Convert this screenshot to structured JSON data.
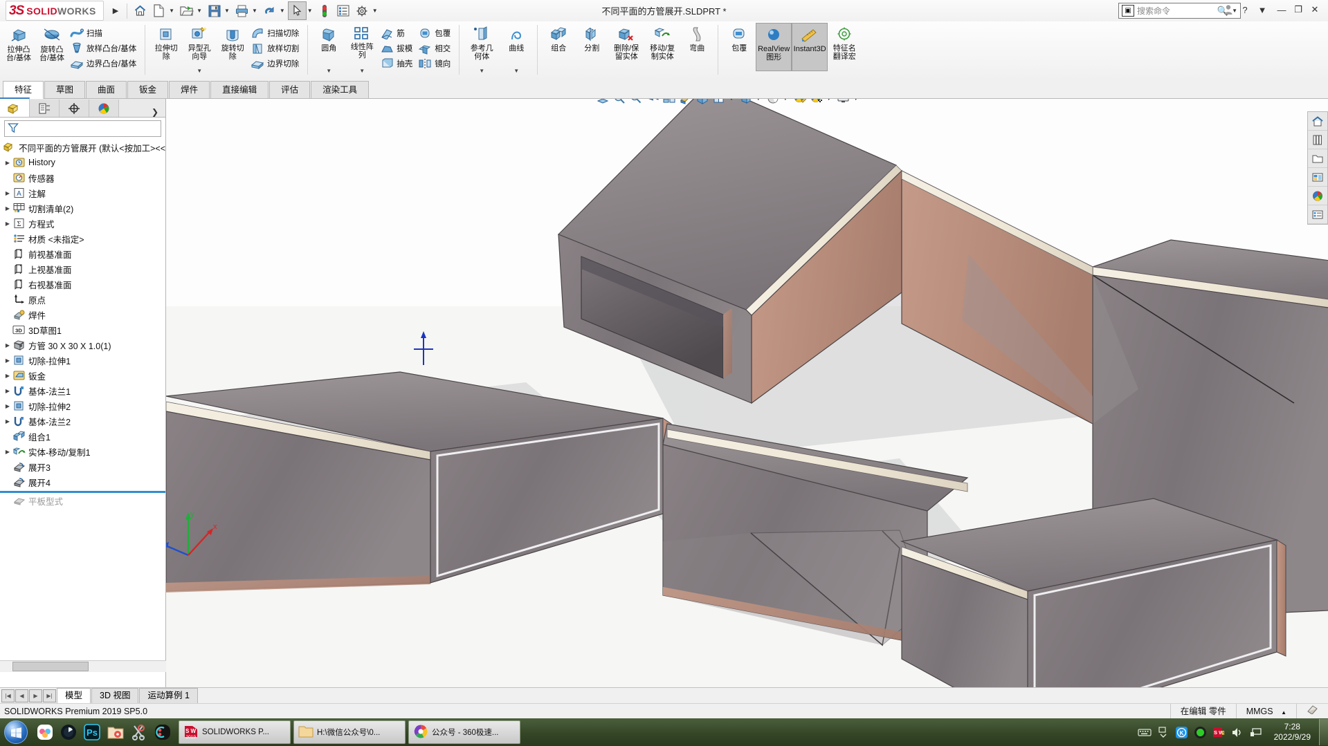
{
  "titlebar": {
    "brand_ds": "3S",
    "brand_solid": "SOLID",
    "brand_works": "WORKS",
    "document_title": "不同平面的方管展开.SLDPRT *",
    "search_placeholder": "搜索命令",
    "icons": [
      "home-icon",
      "new-doc-icon",
      "open-folder-icon",
      "save-icon",
      "print-icon",
      "undo-icon",
      "select-cursor-icon",
      "rebuild-icon",
      "options-list-icon",
      "gear-icon"
    ],
    "help_label": "?",
    "minimize_label": "—",
    "maximize_label": "❐",
    "close_label": "✕"
  },
  "ribbon": {
    "groups": [
      {
        "big": [
          {
            "label": "拉伸凸\n台/基体",
            "icon": "extrude-boss-icon"
          },
          {
            "label": "旋转凸\n台/基体",
            "icon": "revolve-boss-icon"
          }
        ],
        "small": [
          {
            "label": "扫描",
            "icon": "sweep-icon"
          },
          {
            "label": "放样凸台/基体",
            "icon": "loft-boss-icon"
          },
          {
            "label": "边界凸台/基体",
            "icon": "boundary-boss-icon"
          }
        ]
      },
      {
        "big": [
          {
            "label": "拉伸切\n除",
            "icon": "extrude-cut-icon"
          },
          {
            "label": "异型孔\n向导",
            "icon": "hole-wizard-icon",
            "dropdown": true
          },
          {
            "label": "旋转切\n除",
            "icon": "revolve-cut-icon"
          }
        ],
        "small": [
          {
            "label": "扫描切除",
            "icon": "sweep-cut-icon"
          },
          {
            "label": "放样切割",
            "icon": "loft-cut-icon"
          },
          {
            "label": "边界切除",
            "icon": "boundary-cut-icon"
          }
        ]
      },
      {
        "big": [
          {
            "label": "圆角",
            "icon": "fillet-icon",
            "dropdown": true
          },
          {
            "label": "线性阵\n列",
            "icon": "linear-pattern-icon",
            "dropdown": true
          }
        ],
        "small": [
          {
            "label": "筋",
            "icon": "rib-icon"
          },
          {
            "label": "拔模",
            "icon": "draft-icon"
          },
          {
            "label": "抽壳",
            "icon": "shell-icon"
          }
        ],
        "small2": [
          {
            "label": "包覆",
            "icon": "wrap-icon"
          },
          {
            "label": "相交",
            "icon": "intersect-icon"
          },
          {
            "label": "镜向",
            "icon": "mirror-icon"
          }
        ]
      },
      {
        "big": [
          {
            "label": "参考几\n何体",
            "icon": "reference-geometry-icon",
            "dropdown": true
          },
          {
            "label": "曲线",
            "icon": "curves-icon",
            "dropdown": true
          }
        ]
      },
      {
        "big": [
          {
            "label": "组合",
            "icon": "combine-icon"
          },
          {
            "label": "分割",
            "icon": "split-icon"
          },
          {
            "label": "删除/保\n留实体",
            "icon": "delete-keep-body-icon"
          },
          {
            "label": "移动/复\n制实体",
            "icon": "move-copy-body-icon"
          },
          {
            "label": "弯曲",
            "icon": "flex-icon"
          }
        ]
      },
      {
        "big": [
          {
            "label": "包覆",
            "icon": "wrap2-icon"
          },
          {
            "label": "RealView\n图形",
            "icon": "realview-icon",
            "active": true
          },
          {
            "label": "Instant3D",
            "icon": "instant3d-icon",
            "active": true
          },
          {
            "label": "特征名\n翻译宏",
            "icon": "feature-translate-icon"
          }
        ]
      }
    ]
  },
  "tabs": [
    {
      "label": "特征",
      "active": true
    },
    {
      "label": "草图",
      "active": false
    },
    {
      "label": "曲面",
      "active": false
    },
    {
      "label": "钣金",
      "active": false
    },
    {
      "label": "焊件",
      "active": false
    },
    {
      "label": "直接编辑",
      "active": false
    },
    {
      "label": "评估",
      "active": false
    },
    {
      "label": "渲染工具",
      "active": false
    }
  ],
  "feature_manager": {
    "tab_icons": [
      "feature-tree-icon",
      "property-manager-icon",
      "configuration-manager-icon",
      "display-manager-icon"
    ],
    "more_label": "❯",
    "filter_icon": "filter-funnel-icon",
    "root": "不同平面的方管展开  (默认<按加工><<",
    "nodes": [
      {
        "label": "History",
        "icon": "history-icon",
        "expand": true,
        "indent": 1
      },
      {
        "label": "传感器",
        "icon": "sensors-icon",
        "expand": false,
        "indent": 1
      },
      {
        "label": "注解",
        "icon": "annotations-icon",
        "expand": true,
        "indent": 1
      },
      {
        "label": "切割清单(2)",
        "icon": "cut-list-icon",
        "expand": true,
        "indent": 1
      },
      {
        "label": "方程式",
        "icon": "equations-icon",
        "expand": true,
        "indent": 1
      },
      {
        "label": "材质 <未指定>",
        "icon": "material-icon",
        "expand": false,
        "indent": 1
      },
      {
        "label": "前视基准面",
        "icon": "plane-icon",
        "expand": false,
        "indent": 1
      },
      {
        "label": "上视基准面",
        "icon": "plane-icon",
        "expand": false,
        "indent": 1
      },
      {
        "label": "右视基准面",
        "icon": "plane-icon",
        "expand": false,
        "indent": 1
      },
      {
        "label": "原点",
        "icon": "origin-icon",
        "expand": false,
        "indent": 1
      },
      {
        "label": "焊件",
        "icon": "weldment-icon",
        "expand": false,
        "indent": 1
      },
      {
        "label": "3D草图1",
        "icon": "sketch3d-icon",
        "expand": false,
        "indent": 1
      },
      {
        "label": "方管 30 X 30 X 1.0(1)",
        "icon": "structural-member-icon",
        "expand": true,
        "indent": 1
      },
      {
        "label": "切除-拉伸1",
        "icon": "extrude-cut-small-icon",
        "expand": true,
        "indent": 1
      },
      {
        "label": "钣金",
        "icon": "sheetmetal-icon",
        "expand": true,
        "indent": 1
      },
      {
        "label": "基体-法兰1",
        "icon": "base-flange-icon",
        "expand": true,
        "indent": 1
      },
      {
        "label": "切除-拉伸2",
        "icon": "extrude-cut-small-icon",
        "expand": true,
        "indent": 1
      },
      {
        "label": "基体-法兰2",
        "icon": "base-flange-icon",
        "expand": true,
        "indent": 1
      },
      {
        "label": "组合1",
        "icon": "combine-small-icon",
        "expand": false,
        "indent": 1
      },
      {
        "label": "实体-移动/复制1",
        "icon": "move-copy-small-icon",
        "expand": true,
        "indent": 1
      },
      {
        "label": "展开3",
        "icon": "unfold-icon",
        "expand": false,
        "indent": 1
      },
      {
        "label": "展开4",
        "icon": "unfold-icon",
        "expand": false,
        "indent": 1
      }
    ],
    "rollback_bar": true,
    "grayed_node": {
      "label": "平板型式",
      "icon": "flat-pattern-icon"
    }
  },
  "graphics": {
    "view_toolbar_icons": [
      "zoom-to-fit-icon",
      "zoom-to-area-icon",
      "zoom-in-out-icon",
      "previous-view-icon",
      "section-view-icon",
      "view-orientation-icon",
      "view-cube-icon",
      "display-style-icon",
      "hide-show-icon",
      "edit-appearance-icon",
      "apply-scene-icon",
      "view-settings-icon"
    ],
    "window_buttons": [
      "prev-pane",
      "next-pane",
      "minimize",
      "restore",
      "close"
    ],
    "right_toolbar_icons": [
      "home-panel-icon",
      "library-icon",
      "open-folder-panel-icon",
      "layout-panel-icon",
      "appearances-panel-icon",
      "custom-props-icon"
    ],
    "triad_axes": {
      "x": "x",
      "y": "y",
      "z": "z"
    },
    "model_description": "展开的不同平面方管钣金模型"
  },
  "bottom_tabs": [
    {
      "label": "模型",
      "active": true
    },
    {
      "label": "3D 视图",
      "active": false
    },
    {
      "label": "运动算例 1",
      "active": false
    }
  ],
  "status_bar": {
    "version": "SOLIDWORKS Premium 2019 SP5.0",
    "edit_state": "在编辑 零件",
    "units": "MMGS",
    "units_caret": "▲",
    "overlay_icon": "eraser-icon"
  },
  "taskbar": {
    "start_icon": "windows-start-icon",
    "quick_launch": [
      {
        "name": "cloud-app-icon"
      },
      {
        "name": "camera-lens-icon"
      },
      {
        "name": "photoshop-icon"
      },
      {
        "name": "folder-app-icon"
      },
      {
        "name": "snip-tool-icon"
      },
      {
        "name": "ok-app-icon"
      }
    ],
    "tasks": [
      {
        "label": "SOLIDWORKS P...",
        "icon": "sw-task-icon",
        "active": true
      },
      {
        "label": "H:\\微信公众号\\0...",
        "icon": "folder-task-icon",
        "active": false
      },
      {
        "label": "公众号 - 360极速...",
        "icon": "browser-task-icon",
        "active": false
      }
    ],
    "tray": [
      "keyboard-icon",
      "show-hidden-icon",
      "kingsoft-icon",
      "record-icon",
      "sw-alert-icon",
      "volume-icon",
      "network-icon"
    ],
    "clock_time": "7:28",
    "clock_date": "2022/9/29"
  },
  "colors": {
    "accent_red": "#c8102e",
    "selection_blue": "#2f8fd0",
    "ribbon_bg": "#f0f0f0",
    "taskbar_green": "#354627"
  }
}
